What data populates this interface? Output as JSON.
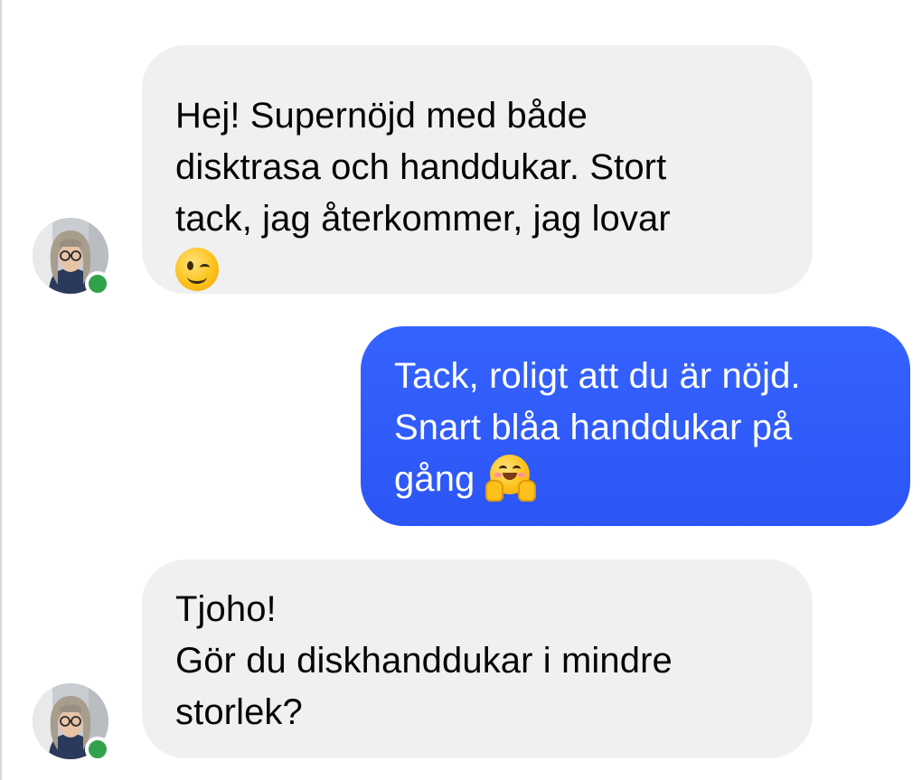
{
  "colors": {
    "incoming_bubble": "#f0f0f0",
    "outgoing_bubble": "#3563ff",
    "outgoing_bubble_gradient_end": "#2c55f5",
    "online_indicator": "#31a24c"
  },
  "conversation": {
    "messages": [
      {
        "direction": "incoming",
        "lines": [
          "Hej! Supernöjd med både",
          "disktrasa och handdukar. Stort",
          "tack, jag återkommer, jag lovar"
        ],
        "emoji": "winking-face",
        "sender_online": true
      },
      {
        "direction": "outgoing",
        "lines": [
          "Tack, roligt att du är nöjd.",
          "Snart blåa handdukar på",
          "gång"
        ],
        "emoji": "hugging-face"
      },
      {
        "direction": "incoming",
        "lines": [
          "Tjoho!",
          "Gör du diskhanddukar i mindre",
          "storlek?"
        ],
        "sender_online": true
      }
    ]
  }
}
